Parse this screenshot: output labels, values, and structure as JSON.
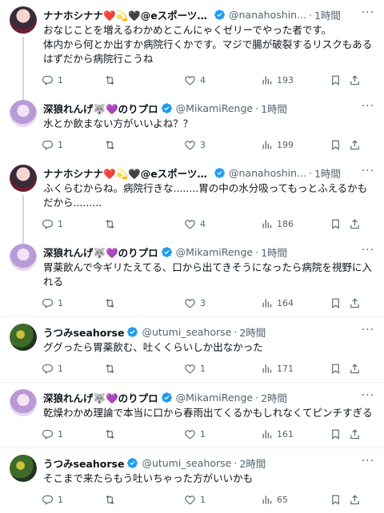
{
  "tweets": [
    {
      "name": "ナナホシナナ❤️💫🖤@eスポーツキャスタ...",
      "handle": "@nanahoshin...",
      "time": "1時間",
      "text": "おなじことを増えるわかめとこんにゃくゼリーでやった者です。\n体内から何とか出すか病院行くかです。マジで腸が破裂するリスクもあるはずだから病院行こうね",
      "replies": "1",
      "reposts": "",
      "likes": "4",
      "views": "193"
    },
    {
      "name": "深狼れんげ🐺💜のりプロ",
      "handle": "@MikamiRenge",
      "time": "1時間",
      "text": "水とか飲まない方がいいよね？？",
      "replies": "1",
      "reposts": "",
      "likes": "3",
      "views": "199"
    },
    {
      "name": "ナナホシナナ❤️💫🖤@eスポーツキャスタ...",
      "handle": "@nanahoshin...",
      "time": "1時間",
      "text": "ふくらむからね。病院行きな........胃の中の水分吸ってもっとふえるかもだから.........",
      "replies": "1",
      "reposts": "",
      "likes": "4",
      "views": "186"
    },
    {
      "name": "深狼れんげ🐺💜のりプロ",
      "handle": "@MikamiRenge",
      "time": "1時間",
      "text": "胃薬飲んで今ギリたえてる、口から出てきそうになったら病院を視野に入れる",
      "replies": "1",
      "reposts": "",
      "likes": "3",
      "views": "164"
    },
    {
      "name": "うつみseahorse",
      "handle": "@utumi_seahorse",
      "time": "2時間",
      "text": "ググったら胃薬飲む、吐くくらいしか出なかった",
      "replies": "1",
      "reposts": "",
      "likes": "1",
      "views": "171"
    },
    {
      "name": "深狼れんげ🐺💜のりプロ",
      "handle": "@MikamiRenge",
      "time": "2時間",
      "text": "乾燥わかめ理論で本当に口から春雨出てくるかもしれなくてピンチすぎる",
      "replies": "1",
      "reposts": "",
      "likes": "1",
      "views": "161"
    },
    {
      "name": "うつみseahorse",
      "handle": "@utumi_seahorse",
      "time": "2時間",
      "text": "そこまで来たらもう吐いちゃった方がいいかも",
      "replies": "1",
      "reposts": "",
      "likes": "1",
      "views": "65"
    }
  ],
  "dot": "·",
  "more": "···",
  "colors": {
    "verified": "#1d9bf0",
    "muted": "#536471",
    "thread": "#cfd9de"
  },
  "icons": [
    "reply-icon",
    "repost-icon",
    "like-icon",
    "views-icon",
    "bookmark-icon",
    "share-icon",
    "verified-badge-icon",
    "more-icon"
  ]
}
